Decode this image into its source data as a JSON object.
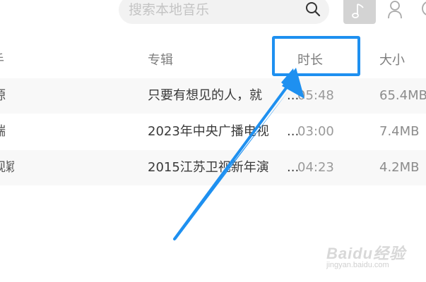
{
  "search": {
    "placeholder": "搜索本地音乐",
    "icon": "search-icon"
  },
  "toolbar": {
    "items": [
      "music-note-icon",
      "singer-icon",
      "album-icon"
    ],
    "active": "music-note-icon"
  },
  "table": {
    "headers": {
      "artist": "手",
      "album": "专辑",
      "duration": "时长",
      "size": "大小"
    },
    "rows": [
      {
        "artist": "源",
        "album": "只要有想见的人，就",
        "duration": "05:48",
        "size": "65.4MB"
      },
      {
        "artist": "端",
        "album": "2023年中央广播电视",
        "duration": "03:00",
        "size": "7.4MB"
      },
      {
        "artist": "观颖",
        "album": "2015江苏卫视新年演",
        "duration": "04:23",
        "size": "4.2MB"
      }
    ],
    "ellipsis": "..."
  },
  "annotation": {
    "color": "#1e90f0",
    "target": "时长"
  },
  "watermark": {
    "brand": "Baidu经验",
    "url": "jingyan.baidu.com"
  },
  "colors": {
    "accent": "#1e90f0",
    "row_alt": "#f8f8f8",
    "header_text": "#7d7d7d"
  }
}
